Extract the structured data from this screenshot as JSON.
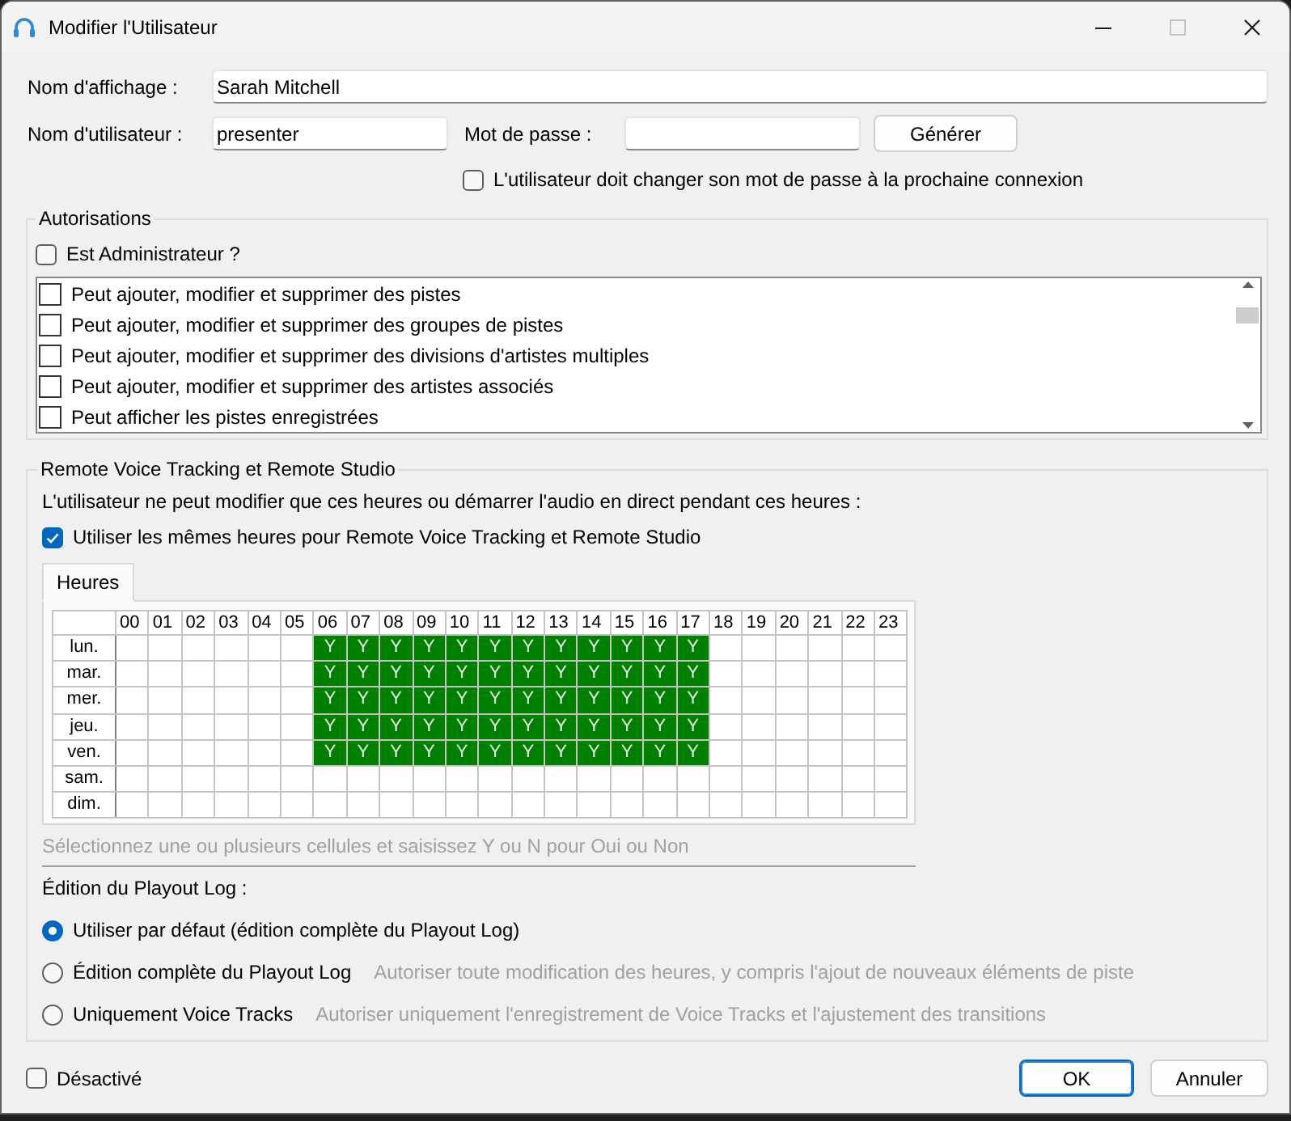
{
  "window": {
    "title": "Modifier l'Utilisateur",
    "controls": [
      {
        "kind": "minimize",
        "disabled": false
      },
      {
        "kind": "maximize",
        "disabled": true
      },
      {
        "kind": "close",
        "disabled": false
      }
    ]
  },
  "account": {
    "display_name": {
      "label": "Nom d'affichage :",
      "value": "Sarah Mitchell"
    },
    "username": {
      "label": "Nom d'utilisateur :",
      "value": "presenter"
    },
    "password": {
      "label": "Mot de passe :"
    },
    "generate_button": "Générer",
    "must_change_password": {
      "label": "L'utilisateur doit changer son mot de passe à la prochaine connexion",
      "checked": false
    }
  },
  "permissions": {
    "title": "Autorisations",
    "is_admin": {
      "label": "Est Administrateur ?",
      "checked": false
    },
    "items": [
      {
        "label": "Peut ajouter, modifier et supprimer des pistes",
        "checked": false
      },
      {
        "label": "Peut ajouter, modifier et supprimer des groupes de pistes",
        "checked": false
      },
      {
        "label": "Peut ajouter, modifier et supprimer des divisions d'artistes multiples",
        "checked": false
      },
      {
        "label": "Peut ajouter, modifier et supprimer des artistes associés",
        "checked": false
      },
      {
        "label": "Peut afficher les pistes enregistrées",
        "checked": false
      }
    ]
  },
  "remote": {
    "title": "Remote Voice Tracking et Remote Studio",
    "description": "L'utilisateur ne peut modifier que ces heures ou démarrer l'audio en direct pendant ces heures :",
    "same_hours": {
      "label": "Utiliser les mêmes heures pour Remote Voice Tracking et Remote Studio",
      "checked": true
    },
    "tabs": [
      {
        "label": "Heures",
        "selected": true
      }
    ],
    "schedule": {
      "hours": [
        "00",
        "01",
        "02",
        "03",
        "04",
        "05",
        "06",
        "07",
        "08",
        "09",
        "10",
        "11",
        "12",
        "13",
        "14",
        "15",
        "16",
        "17",
        "18",
        "19",
        "20",
        "21",
        "22",
        "23"
      ],
      "days": [
        {
          "label": "lun.",
          "cells": [
            null,
            null,
            null,
            null,
            null,
            null,
            "Y",
            "Y",
            "Y",
            "Y",
            "Y",
            "Y",
            "Y",
            "Y",
            "Y",
            "Y",
            "Y",
            "Y",
            null,
            null,
            null,
            null,
            null,
            null
          ]
        },
        {
          "label": "mar.",
          "cells": [
            null,
            null,
            null,
            null,
            null,
            null,
            "Y",
            "Y",
            "Y",
            "Y",
            "Y",
            "Y",
            "Y",
            "Y",
            "Y",
            "Y",
            "Y",
            "Y",
            null,
            null,
            null,
            null,
            null,
            null
          ]
        },
        {
          "label": "mer.",
          "cells": [
            null,
            null,
            null,
            null,
            null,
            null,
            "Y",
            "Y",
            "Y",
            "Y",
            "Y",
            "Y",
            "Y",
            "Y",
            "Y",
            "Y",
            "Y",
            "Y",
            null,
            null,
            null,
            null,
            null,
            null
          ]
        },
        {
          "label": "jeu.",
          "cells": [
            null,
            null,
            null,
            null,
            null,
            null,
            "Y",
            "Y",
            "Y",
            "Y",
            "Y",
            "Y",
            "Y",
            "Y",
            "Y",
            "Y",
            "Y",
            "Y",
            null,
            null,
            null,
            null,
            null,
            null
          ]
        },
        {
          "label": "ven.",
          "cells": [
            null,
            null,
            null,
            null,
            null,
            null,
            "Y",
            "Y",
            "Y",
            "Y",
            "Y",
            "Y",
            "Y",
            "Y",
            "Y",
            "Y",
            "Y",
            "Y",
            null,
            null,
            null,
            null,
            null,
            null
          ]
        },
        {
          "label": "sam.",
          "cells": [
            null,
            null,
            null,
            null,
            null,
            null,
            null,
            null,
            null,
            null,
            null,
            null,
            null,
            null,
            null,
            null,
            null,
            null,
            null,
            null,
            null,
            null,
            null,
            null
          ]
        },
        {
          "label": "dim.",
          "cells": [
            null,
            null,
            null,
            null,
            null,
            null,
            null,
            null,
            null,
            null,
            null,
            null,
            null,
            null,
            null,
            null,
            null,
            null,
            null,
            null,
            null,
            null,
            null,
            null
          ]
        }
      ]
    },
    "hint": "Sélectionnez une ou plusieurs cellules et saisissez Y ou N pour Oui ou Non",
    "playout_log": {
      "label": "Édition du Playout Log :",
      "options": [
        {
          "label": "Utiliser par défaut (édition complète du Playout Log)",
          "selected": true
        },
        {
          "label": "Édition complète du Playout Log",
          "description": "Autoriser toute modification des heures, y compris l'ajout de nouveaux éléments de piste",
          "selected": false
        },
        {
          "label": "Uniquement Voice Tracks",
          "description": "Autoriser uniquement l'enregistrement de Voice Tracks et l'ajustement des transitions",
          "selected": false
        }
      ]
    }
  },
  "disabled": {
    "label": "Désactivé",
    "checked": false
  },
  "buttons": [
    {
      "label": "OK",
      "default": true
    },
    {
      "label": "Annuler",
      "default": false
    }
  ]
}
